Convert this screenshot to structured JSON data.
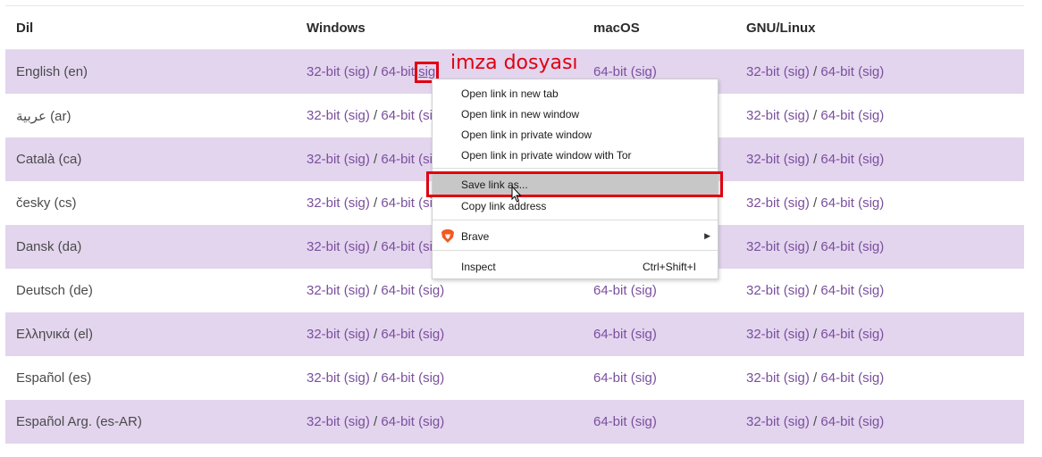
{
  "table": {
    "headers": {
      "lang": "Dil",
      "windows": "Windows",
      "macos": "macOS",
      "linux": "GNU/Linux"
    },
    "link_labels": {
      "bit32": "32-bit",
      "bit64": "64-bit",
      "sig": "(sig)",
      "sig_bare": "sig",
      "slash": "/"
    },
    "rows": [
      {
        "lang": "English (en)"
      },
      {
        "lang": "عربية (ar)"
      },
      {
        "lang": "Català (ca)"
      },
      {
        "lang": "česky (cs)"
      },
      {
        "lang": "Dansk (da)"
      },
      {
        "lang": "Deutsch (de)"
      },
      {
        "lang": "Ελληνικά (el)"
      },
      {
        "lang": "Español (es)"
      },
      {
        "lang": "Español Arg. (es-AR)"
      }
    ]
  },
  "annotation": {
    "text": "imza dosyası",
    "color": "#e00010"
  },
  "context_menu": {
    "items": {
      "new_tab": "Open link in new tab",
      "new_window": "Open link in new window",
      "private_window": "Open link in private window",
      "private_tor": "Open link in private window with Tor",
      "save_link": "Save link as...",
      "copy_link": "Copy link address",
      "brave": "Brave",
      "inspect": "Inspect",
      "inspect_shortcut": "Ctrl+Shift+I"
    }
  },
  "colors": {
    "stripe": "#e3d5ee",
    "link": "#7a4f9e",
    "highlight": "#e00010"
  },
  "icons": {
    "brave": "brave-lion-icon",
    "submenu": "chevron-right-icon",
    "cursor": "mouse-pointer-icon"
  }
}
